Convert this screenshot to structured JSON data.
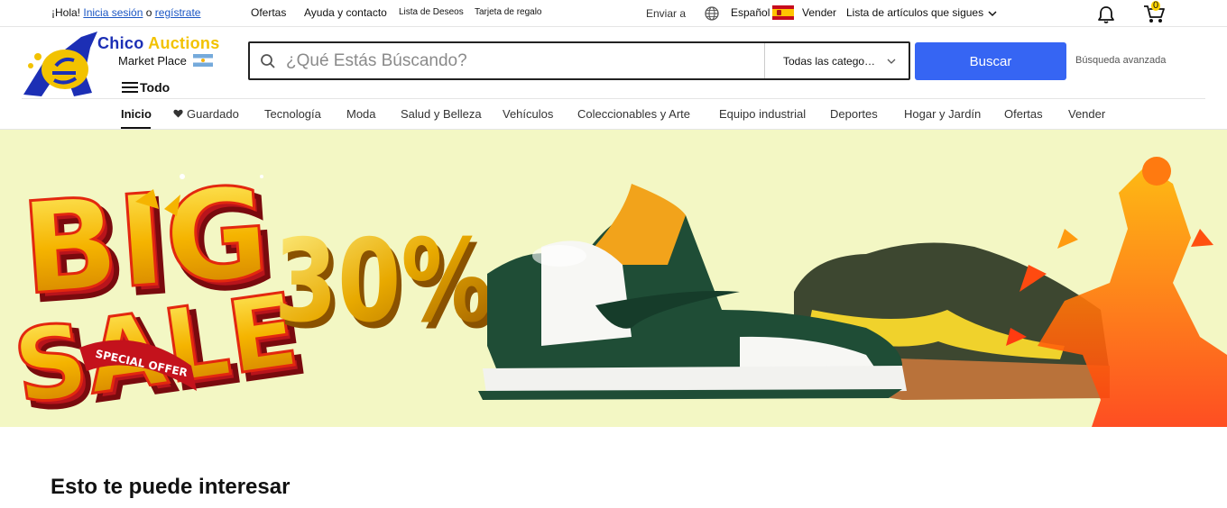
{
  "topbar": {
    "greeting": "¡Hola!",
    "signin": "Inicia sesión",
    "or": "o",
    "register": "regístrate",
    "ofertas": "Ofertas",
    "ayuda": "Ayuda y contacto",
    "lista_deseos": "Lista de Deseos",
    "tarjeta": "Tarjeta de regalo",
    "enviar": "Enviar a",
    "idioma": "Español",
    "vender": "Vender",
    "seguidos": "Lista de artículos que sigues",
    "cart_count": "0"
  },
  "logo": {
    "name_a": "Chico ",
    "name_b": "Auctions",
    "sub": "Market Place"
  },
  "header": {
    "todo": "Todo",
    "search_placeholder": "¿Qué Estás Búscando?",
    "category": "Todas las catego…",
    "buscar": "Buscar",
    "advanced": "Búsqueda avanzada"
  },
  "nav": [
    "Inicio",
    "Guardado",
    "Tecnología",
    "Moda",
    "Salud y Belleza",
    "Vehículos",
    "Coleccionables y Arte",
    "Equipo industrial",
    "Deportes",
    "Hogar y Jardín",
    "Ofertas",
    "Vender"
  ],
  "banner": {
    "big": "BIG",
    "sale": "SALE",
    "special": "SPECIAL OFFER",
    "percent": "30%"
  },
  "section": {
    "heading": "Esto te puede interesar"
  },
  "colors": {
    "accent": "#3665f3",
    "banner_bg": "#f3f7c4",
    "logo_blue": "#1c2fb5",
    "logo_yellow": "#f2c200"
  }
}
